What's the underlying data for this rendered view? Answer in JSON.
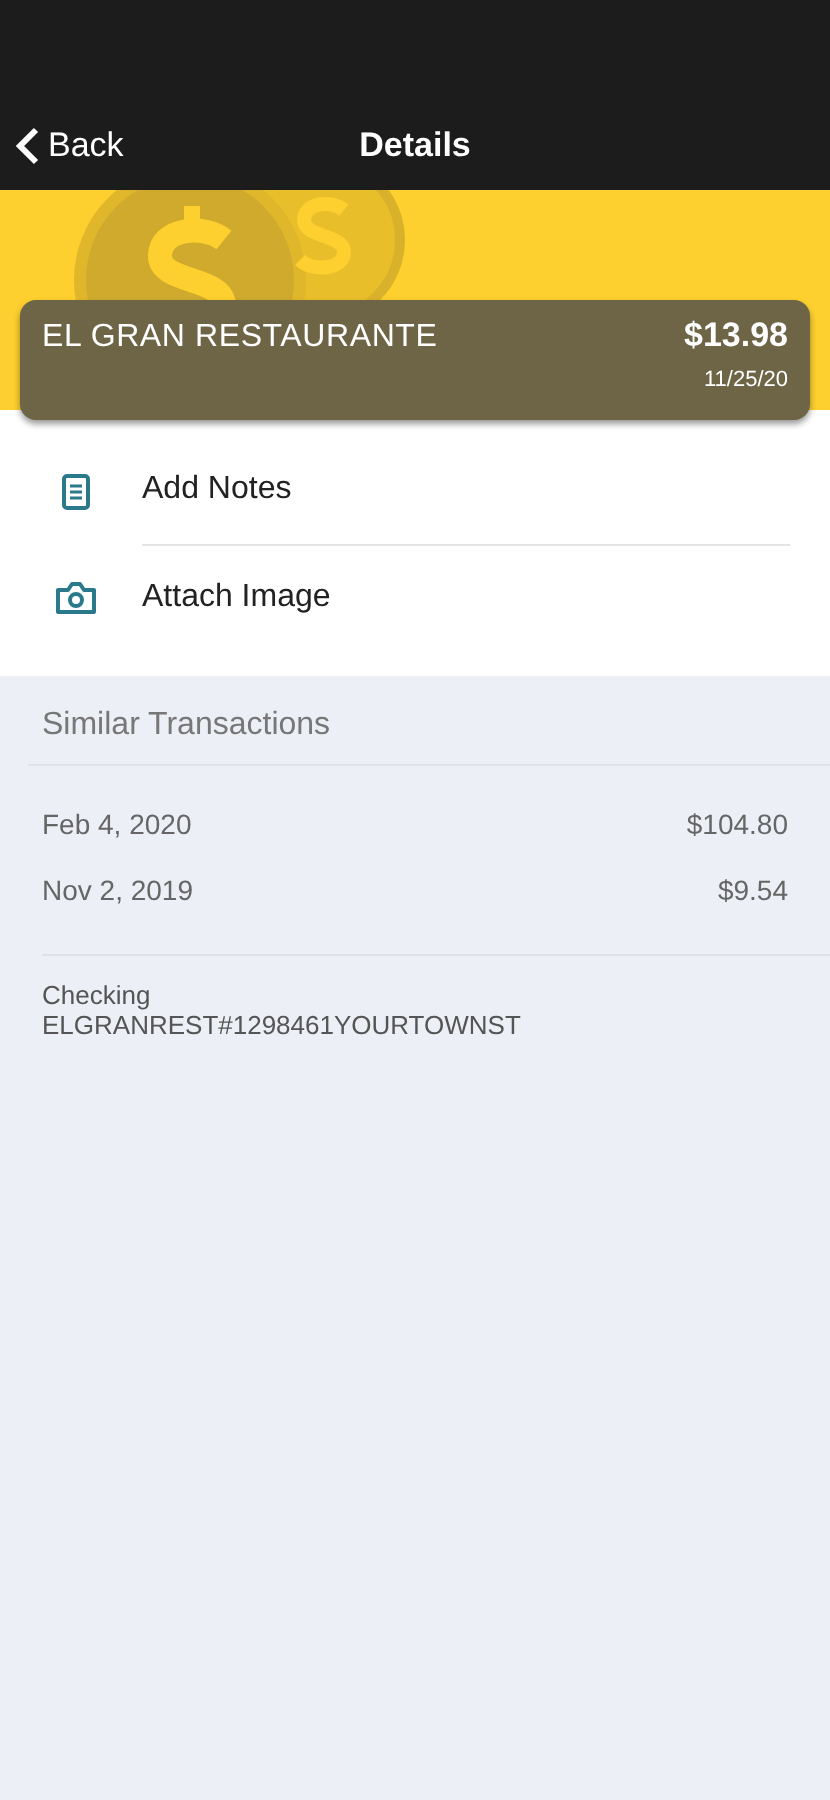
{
  "nav": {
    "back": "Back",
    "title": "Details"
  },
  "transaction": {
    "merchant": "EL GRAN RESTAURANTE",
    "amount": "$13.98",
    "date": "11/25/20"
  },
  "actions": [
    {
      "kind": "notes",
      "label": "Add Notes"
    },
    {
      "kind": "camera",
      "label": "Attach Image"
    }
  ],
  "similar": {
    "title": "Similar Transactions",
    "rows": [
      {
        "date": "Feb 4, 2020",
        "amount": "$104.80"
      },
      {
        "date": "Nov 2, 2019",
        "amount": "$9.54"
      }
    ]
  },
  "account": {
    "name": "Checking",
    "description": "ELGRANREST#1298461YOURTOWNST"
  }
}
